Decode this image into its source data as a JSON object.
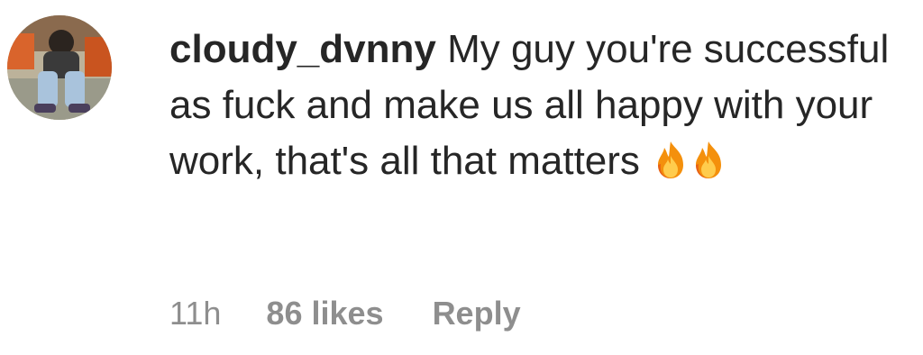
{
  "comment": {
    "username": "cloudy_dvnny",
    "text": "My guy you're successful as fuck and make us all happy with your work, that's all that matters",
    "emojis": [
      "fire-icon",
      "fire-icon"
    ],
    "timestamp": "11h",
    "likes": "86 likes",
    "reply_label": "Reply"
  },
  "colors": {
    "text": "#262626",
    "meta": "#8e8e8e",
    "background": "#ffffff"
  }
}
